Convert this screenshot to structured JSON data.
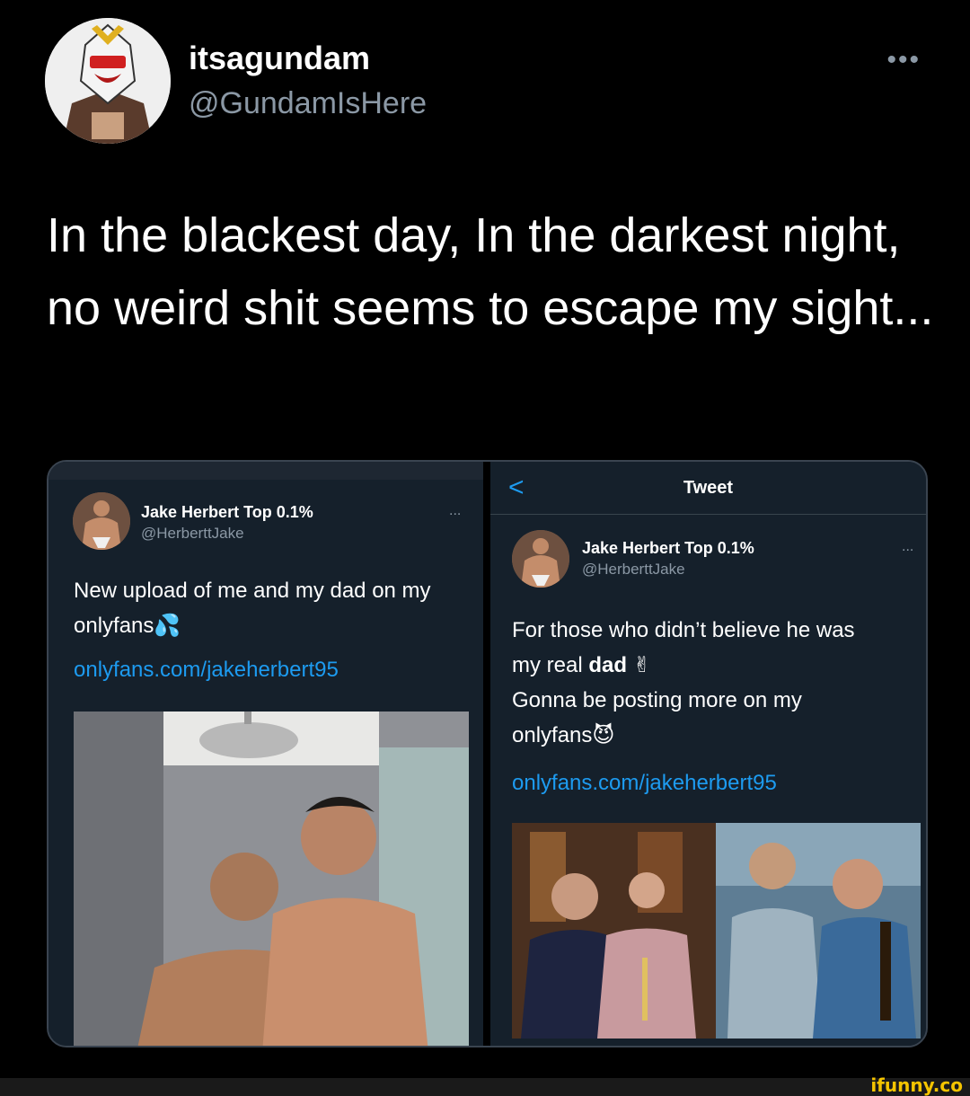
{
  "tweet": {
    "author_name": "itsagundam",
    "author_handle": "@GundamIsHere",
    "more_label": "•••",
    "text": "In the blackest day, In the darkest night, no weird shit seems to escape my sight..."
  },
  "left_panel": {
    "author_name": "Jake Herbert Top 0.1%",
    "author_handle": "@HerberttJake",
    "more_label": "...",
    "text": "New upload of me and my dad on my onlyfans💦",
    "link": "onlyfans.com/jakeherbert95"
  },
  "right_panel": {
    "nav_back": "<",
    "nav_title": "Tweet",
    "author_name": "Jake Herbert Top 0.1%",
    "author_handle": "@HerberttJake",
    "more_label": "...",
    "text_line1": "For those who didn’t believe he was",
    "text_line2_prefix": "my real ",
    "text_line2_bold": "dad",
    "text_line2_suffix": " ✌",
    "text_line3": "Gonna be posting more on my",
    "text_line4": "onlyfans😈",
    "link": "onlyfans.com/jakeherbert95"
  },
  "watermark": "ifunny.co",
  "colors": {
    "background": "#000000",
    "panel_background": "#15202b",
    "link": "#1d9bf0",
    "secondary_text": "#8b98a5"
  }
}
